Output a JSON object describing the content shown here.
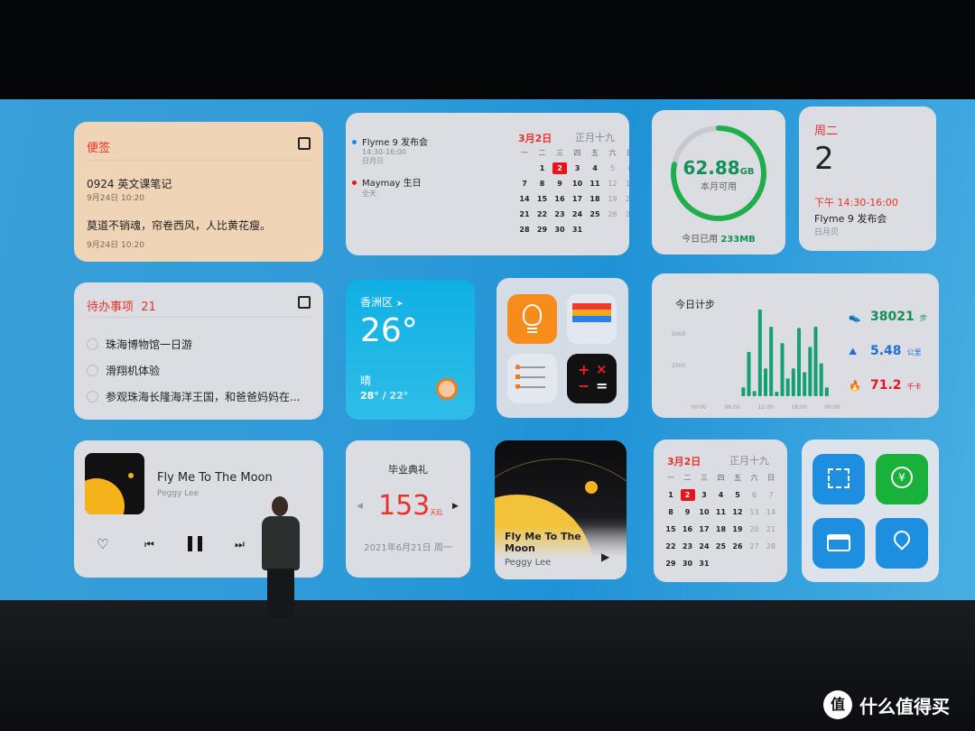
{
  "notes": {
    "title": "便签",
    "items": [
      {
        "text": "0924 英文课笔记",
        "time": "9月24日 10:20"
      },
      {
        "text": "莫道不销魂，帘卷西风，人比黄花瘦。",
        "time": "9月24日 10:20"
      }
    ]
  },
  "schedule": {
    "events": [
      {
        "title": "Flyme 9 发布会",
        "time": "14:30-16:00",
        "place": "日月贝",
        "dot": "#1e88e5"
      },
      {
        "title": "Maymay 生日",
        "time": "全天",
        "dot": "#e8141b"
      }
    ],
    "date": "3月2日",
    "lunar": "正月十九",
    "weekdays": [
      "一",
      "二",
      "三",
      "四",
      "五",
      "六",
      "日"
    ],
    "offset": 1,
    "days": 31,
    "today": 2
  },
  "storage": {
    "value": "62.88",
    "unit": "GB",
    "label": "本月可用",
    "used_label": "今日已用",
    "used": "233MB",
    "fraction": 0.78
  },
  "day": {
    "weekday": "周二",
    "date": "2",
    "time": "下午 14:30-16:00",
    "event": "Flyme 9 发布会",
    "place": "日月贝"
  },
  "todo": {
    "title": "待办事项",
    "count": "21",
    "items": [
      "珠海博物馆一日游",
      "滑翔机体验",
      "参观珠海长隆海洋王国，和爸爸妈妈在..."
    ]
  },
  "weather": {
    "location": "香洲区",
    "temp": "26°",
    "condition": "晴",
    "high": "28°",
    "sep": " / ",
    "low": "22°"
  },
  "apps": {
    "icons": [
      "lightbulb-icon",
      "wallet-cards-icon",
      "list-icon",
      "calculator-icon"
    ]
  },
  "steps": {
    "title": "今日计步",
    "yticks": [
      "5000",
      "2500"
    ],
    "xticks": [
      "00:00",
      "06:00",
      "12:00",
      "18:00",
      "00:00"
    ],
    "hours": [
      8,
      9,
      10,
      11,
      12,
      13,
      14,
      15,
      16,
      17,
      18,
      19,
      20,
      21,
      22,
      23
    ],
    "values": [
      700,
      3500,
      400,
      7100,
      2200,
      5500,
      350,
      4200,
      1400,
      2200,
      5400,
      1900,
      3900,
      5500,
      2600,
      700
    ],
    "stats": [
      {
        "value": "38021",
        "unit": "步",
        "color": "#11905a"
      },
      {
        "value": "5.48",
        "unit": "公里",
        "color": "#1f6fd6"
      },
      {
        "value": "71.2",
        "unit": "千卡",
        "color": "#e8141b"
      }
    ]
  },
  "music": {
    "title": "Fly Me To The Moon",
    "artist": "Peggy Lee"
  },
  "countdown": {
    "title": "毕业典礼",
    "days": "153",
    "suffix": "天后",
    "date": "2021年6月21日 周一"
  },
  "music2": {
    "title": "Fly Me To The Moon",
    "artist": "Peggy Lee"
  },
  "calendar2": {
    "date": "3月2日",
    "lunar": "正月十九",
    "weekdays": [
      "一",
      "二",
      "三",
      "四",
      "五",
      "六",
      "日"
    ],
    "offset": 0,
    "days": 31,
    "today": 2
  },
  "quick": {
    "icons": [
      "scan-icon",
      "wechat-pay-icon",
      "card-icon",
      "location-icon"
    ]
  },
  "watermark": {
    "text": "什么值得买",
    "badge": "值"
  }
}
